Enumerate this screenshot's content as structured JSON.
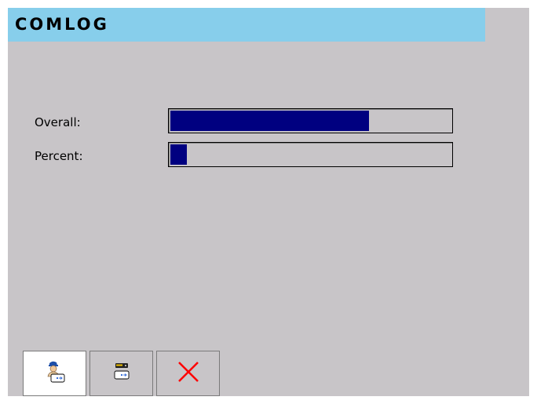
{
  "app": {
    "title": "COMLOG"
  },
  "progress": {
    "overall": {
      "label": "Overall:",
      "value": 0.71
    },
    "percent": {
      "label": "Percent:",
      "value": 0.06
    }
  },
  "toolbar": {
    "buttons": [
      {
        "name": "user-transfer-button",
        "icon": "user-transfer-icon",
        "active": true
      },
      {
        "name": "device-transfer-button",
        "icon": "device-transfer-icon",
        "active": false
      },
      {
        "name": "cancel-button",
        "icon": "close-icon",
        "active": false
      }
    ]
  },
  "colors": {
    "title_bar": "#87ceeb",
    "window_bg": "#c8c5c8",
    "progress_fill": "#000080",
    "cancel_x": "#ff0000"
  }
}
